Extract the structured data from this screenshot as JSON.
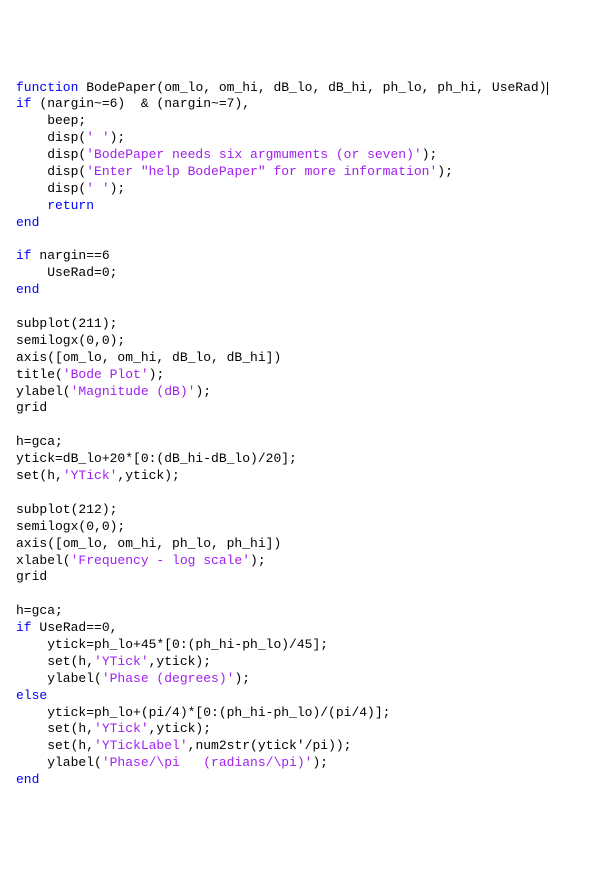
{
  "code": {
    "lines": [
      {
        "segments": [
          {
            "t": "function",
            "c": "kw"
          },
          {
            "t": " BodePaper(om_lo, om_hi, dB_lo, dB_hi, ph_lo, ph_hi, UseRad)"
          }
        ],
        "cursorAfter": true
      },
      {
        "segments": [
          {
            "t": "if",
            "c": "kw"
          },
          {
            "t": " (nargin~=6)  & (nargin~=7),"
          }
        ]
      },
      {
        "segments": [
          {
            "t": "    beep;"
          }
        ]
      },
      {
        "segments": [
          {
            "t": "    disp("
          },
          {
            "t": "' '",
            "c": "str"
          },
          {
            "t": ");"
          }
        ]
      },
      {
        "segments": [
          {
            "t": "    disp("
          },
          {
            "t": "'BodePaper needs six argmuments (or seven)'",
            "c": "str"
          },
          {
            "t": ");"
          }
        ]
      },
      {
        "segments": [
          {
            "t": "    disp("
          },
          {
            "t": "'Enter \"help BodePaper\" for more information'",
            "c": "str"
          },
          {
            "t": ");"
          }
        ]
      },
      {
        "segments": [
          {
            "t": "    disp("
          },
          {
            "t": "' '",
            "c": "str"
          },
          {
            "t": ");"
          }
        ]
      },
      {
        "segments": [
          {
            "t": "    "
          },
          {
            "t": "return",
            "c": "kw"
          }
        ]
      },
      {
        "segments": [
          {
            "t": "end",
            "c": "kw"
          }
        ]
      },
      {
        "segments": [
          {
            "t": ""
          }
        ]
      },
      {
        "segments": [
          {
            "t": "if",
            "c": "kw"
          },
          {
            "t": " nargin==6"
          }
        ]
      },
      {
        "segments": [
          {
            "t": "    UseRad=0;"
          }
        ]
      },
      {
        "segments": [
          {
            "t": "end",
            "c": "kw"
          }
        ]
      },
      {
        "segments": [
          {
            "t": ""
          }
        ]
      },
      {
        "segments": [
          {
            "t": "subplot(211);"
          }
        ]
      },
      {
        "segments": [
          {
            "t": "semilogx(0,0);"
          }
        ]
      },
      {
        "segments": [
          {
            "t": "axis([om_lo, om_hi, dB_lo, dB_hi])"
          }
        ]
      },
      {
        "segments": [
          {
            "t": "title("
          },
          {
            "t": "'Bode Plot'",
            "c": "str"
          },
          {
            "t": ");"
          }
        ]
      },
      {
        "segments": [
          {
            "t": "ylabel("
          },
          {
            "t": "'Magnitude (dB)'",
            "c": "str"
          },
          {
            "t": ");"
          }
        ]
      },
      {
        "segments": [
          {
            "t": "grid"
          }
        ]
      },
      {
        "segments": [
          {
            "t": ""
          }
        ]
      },
      {
        "segments": [
          {
            "t": "h=gca;"
          }
        ]
      },
      {
        "segments": [
          {
            "t": "ytick=dB_lo+20*[0:(dB_hi-dB_lo)/20];"
          }
        ]
      },
      {
        "segments": [
          {
            "t": "set(h,"
          },
          {
            "t": "'YTick'",
            "c": "str"
          },
          {
            "t": ",ytick);"
          }
        ]
      },
      {
        "segments": [
          {
            "t": ""
          }
        ]
      },
      {
        "segments": [
          {
            "t": "subplot(212);"
          }
        ]
      },
      {
        "segments": [
          {
            "t": "semilogx(0,0);"
          }
        ]
      },
      {
        "segments": [
          {
            "t": "axis([om_lo, om_hi, ph_lo, ph_hi])"
          }
        ]
      },
      {
        "segments": [
          {
            "t": "xlabel("
          },
          {
            "t": "'Frequency - log scale'",
            "c": "str"
          },
          {
            "t": ");"
          }
        ]
      },
      {
        "segments": [
          {
            "t": "grid"
          }
        ]
      },
      {
        "segments": [
          {
            "t": ""
          }
        ]
      },
      {
        "segments": [
          {
            "t": "h=gca;"
          }
        ]
      },
      {
        "segments": [
          {
            "t": "if",
            "c": "kw"
          },
          {
            "t": " UseRad==0,"
          }
        ]
      },
      {
        "segments": [
          {
            "t": "    ytick=ph_lo+45*[0:(ph_hi-ph_lo)/45];"
          }
        ]
      },
      {
        "segments": [
          {
            "t": "    set(h,"
          },
          {
            "t": "'YTick'",
            "c": "str"
          },
          {
            "t": ",ytick);"
          }
        ]
      },
      {
        "segments": [
          {
            "t": "    ylabel("
          },
          {
            "t": "'Phase (degrees)'",
            "c": "str"
          },
          {
            "t": ");"
          }
        ]
      },
      {
        "segments": [
          {
            "t": "else",
            "c": "kw"
          }
        ]
      },
      {
        "segments": [
          {
            "t": "    ytick=ph_lo+(pi/4)*[0:(ph_hi-ph_lo)/(pi/4)];"
          }
        ]
      },
      {
        "segments": [
          {
            "t": "    set(h,"
          },
          {
            "t": "'YTick'",
            "c": "str"
          },
          {
            "t": ",ytick);"
          }
        ]
      },
      {
        "segments": [
          {
            "t": "    set(h,"
          },
          {
            "t": "'YTickLabel'",
            "c": "str"
          },
          {
            "t": ",num2str(ytick'/pi));"
          }
        ]
      },
      {
        "segments": [
          {
            "t": "    ylabel("
          },
          {
            "t": "'Phase/\\pi   (radians/\\pi)'",
            "c": "str"
          },
          {
            "t": ");"
          }
        ]
      },
      {
        "segments": [
          {
            "t": "end",
            "c": "kw"
          }
        ]
      }
    ]
  }
}
